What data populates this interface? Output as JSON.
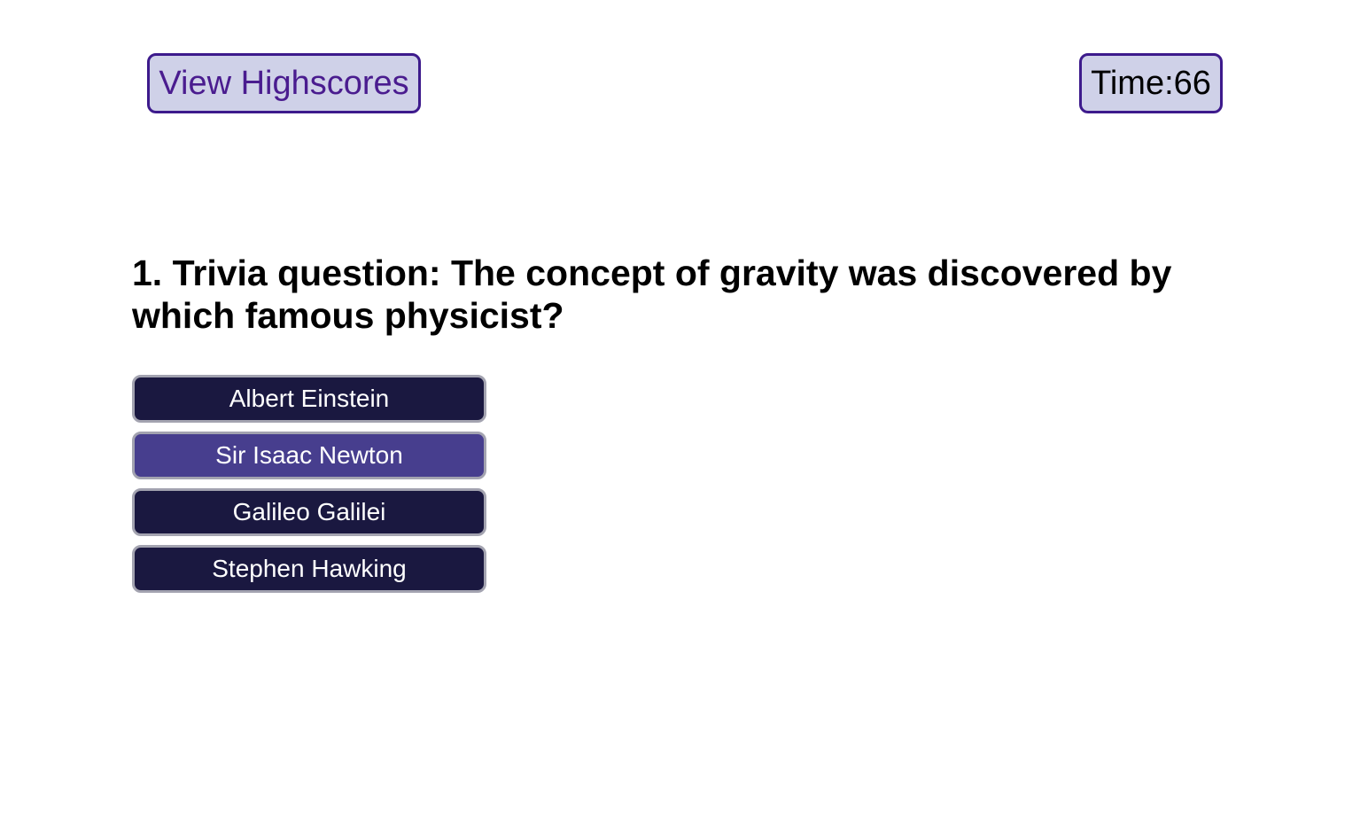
{
  "header": {
    "highscores_label": "View Highscores",
    "timer_label": "Time:",
    "timer_value": "66"
  },
  "quiz": {
    "question": "1. Trivia question: The concept of gravity was discovered by which famous physicist?",
    "choices": [
      {
        "label": "Albert Einstein"
      },
      {
        "label": "Sir Isaac Newton",
        "state": "hovered"
      },
      {
        "label": "Galileo Galilei"
      },
      {
        "label": "Stephen Hawking"
      }
    ]
  },
  "colors": {
    "accent_border": "#3d1a8c",
    "pill_background": "#cfd1e8",
    "choice_background": "#1a1840",
    "choice_hover_background": "#473e8e"
  }
}
